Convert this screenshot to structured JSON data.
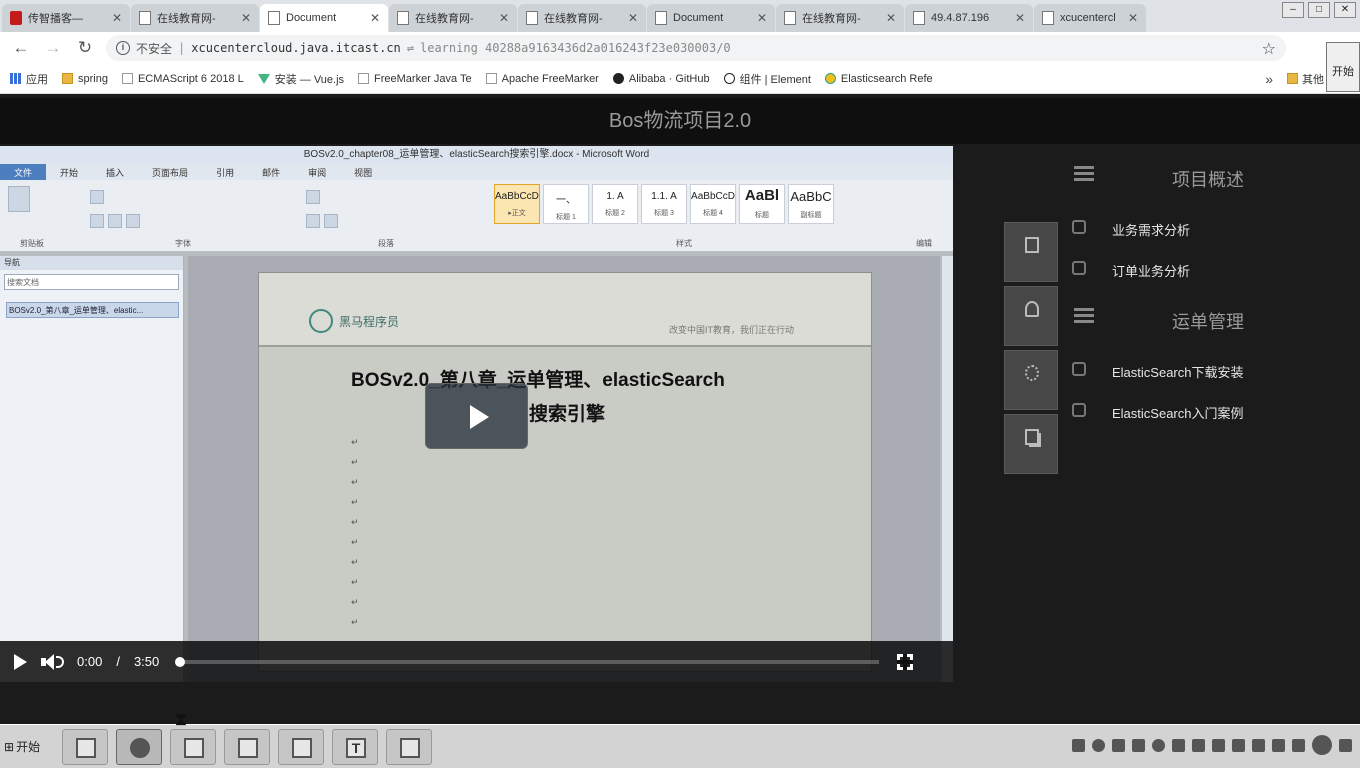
{
  "browser": {
    "tabs": [
      {
        "label": "传智播客—",
        "icon": "red-favicon-icon",
        "active": false
      },
      {
        "label": "在线教育网-",
        "icon": "page-icon",
        "active": false
      },
      {
        "label": "Document",
        "icon": "page-icon",
        "active": true
      },
      {
        "label": "在线教育网-",
        "icon": "page-icon",
        "active": false
      },
      {
        "label": "在线教育网-",
        "icon": "page-icon",
        "active": false
      },
      {
        "label": "Document",
        "icon": "page-icon",
        "active": false
      },
      {
        "label": "在线教育网-",
        "icon": "page-icon",
        "active": false
      },
      {
        "label": "49.4.87.196",
        "icon": "page-icon",
        "active": false
      },
      {
        "label": "xcucentercl",
        "icon": "page-icon",
        "active": false
      }
    ],
    "window_controls": [
      "–",
      "□",
      "✕"
    ],
    "url": {
      "security_label": "不安全",
      "host": "xcucentercloud.java.itcast.cn",
      "separator": "⇌",
      "path": "learning 40288a9163436d2a016243f23e030003/0"
    },
    "bookmarks": [
      {
        "label": "应用",
        "icon": "apps-grid-icon"
      },
      {
        "label": "spring",
        "icon": "folder-icon"
      },
      {
        "label": "ECMAScript 6 2018 L",
        "icon": "page-icon"
      },
      {
        "label": "安装 — Vue.js",
        "icon": "vue-icon"
      },
      {
        "label": "FreeMarker Java Te",
        "icon": "page-icon"
      },
      {
        "label": "Apache FreeMarker",
        "icon": "page-icon"
      },
      {
        "label": "Alibaba · GitHub",
        "icon": "github-icon"
      },
      {
        "label": "组件 | Element",
        "icon": "element-icon"
      },
      {
        "label": "Elasticsearch Refe",
        "icon": "elastic-icon"
      }
    ],
    "bookmarks_more": "»",
    "other_bookmarks": "其他",
    "side_start": "开始"
  },
  "page": {
    "header_title": "Bos物流项目2.0",
    "video": {
      "word_window_title": "BOSv2.0_chapter08_运单管理、elasticSearch搜索引擎.docx - Microsoft Word",
      "ribbon_tabs": [
        "文件",
        "开始",
        "插入",
        "页面布局",
        "引用",
        "邮件",
        "审阅",
        "视图"
      ],
      "ribbon_styles": [
        {
          "preview": "AaBbCcDd",
          "name": "▸正文"
        },
        {
          "preview": "一、",
          "name": "标题 1"
        },
        {
          "preview": "1.  A",
          "name": "标题 2"
        },
        {
          "preview": "1.1.  A",
          "name": "标题 3"
        },
        {
          "preview": "AaBbCcD",
          "name": "标题 4"
        },
        {
          "preview": "AaBl",
          "name": "标题"
        },
        {
          "preview": "AaBbC",
          "name": "副标题"
        }
      ],
      "ribbon_groups": [
        "剪贴板",
        "字体",
        "段落",
        "样式",
        "编辑"
      ],
      "nav_pane_title": "导航",
      "nav_search": "搜索文档",
      "nav_item": "BOSv2.0_第八章_运单管理、elastic...",
      "doc_logo_text": "黑马程序员",
      "doc_tagline": "改变中国IT教育，我们正在行动",
      "doc_heading_line1": "BOSv2.0_第八章_运单管理、elasticSearch",
      "doc_heading_line2": "搜索引擎"
    },
    "player": {
      "current_time": "0:00",
      "separator": "/",
      "duration": "3:50",
      "progress": 0
    },
    "side_tools": [
      {
        "label": "目录",
        "icon": "document-icon"
      },
      {
        "label": "笔记",
        "icon": "person-icon"
      },
      {
        "label": "设置",
        "icon": "gear-icon"
      },
      {
        "label": "资料",
        "icon": "copy-icon"
      }
    ],
    "toc": [
      {
        "type": "section",
        "title": "项目概述"
      },
      {
        "type": "item",
        "label": "业务需求分析"
      },
      {
        "type": "item",
        "label": "订单业务分析"
      },
      {
        "type": "section",
        "title": "运单管理"
      },
      {
        "type": "item",
        "label": "ElasticSearch下载安装"
      },
      {
        "type": "item",
        "label": "ElasticSearch入门案例"
      }
    ]
  },
  "taskbar": {
    "start_label": "开始",
    "apps": [
      "explorer-icon",
      "chrome-icon",
      "intellij-icon",
      "tool-icon",
      "notepad-icon",
      "text-editor-icon",
      "cursor-app-icon"
    ],
    "text_editor_glyph": "T"
  },
  "colors": {
    "page_background": "#1b1b1b",
    "header_background": "#0f0f0f",
    "muted_text": "#9a9a9a",
    "toc_item_text": "#e6e6e6"
  }
}
